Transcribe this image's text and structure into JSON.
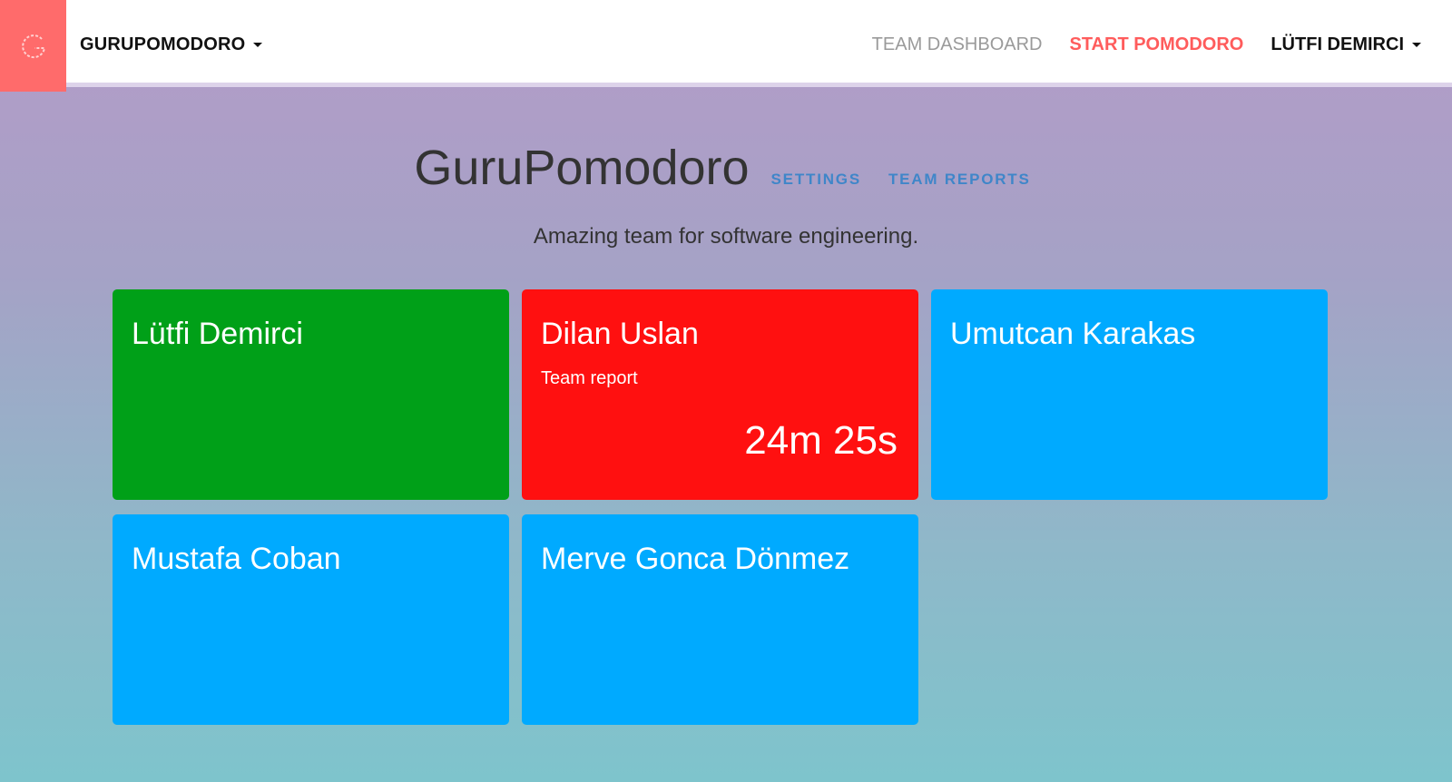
{
  "navbar": {
    "logo_letter": "G",
    "brand": "GURUPOMODORO",
    "links": {
      "dashboard": "TEAM DASHBOARD",
      "start": "START POMODORO",
      "user": "LÜTFI DEMIRCI"
    }
  },
  "header": {
    "title": "GuruPomodoro",
    "settings": "SETTINGS",
    "reports": "TEAM REPORTS",
    "tagline": "Amazing team for software engineering."
  },
  "members": [
    {
      "name": "Lütfi Demirci",
      "status_color": "#00a018",
      "task": "",
      "timer": ""
    },
    {
      "name": "Dilan Uslan",
      "status_color": "#ff1010",
      "task": "Team report",
      "timer": "24m 25s"
    },
    {
      "name": "Umutcan Karakas",
      "status_color": "#00aaff",
      "task": "",
      "timer": ""
    },
    {
      "name": "Mustafa Coban",
      "status_color": "#00aaff",
      "task": "",
      "timer": ""
    },
    {
      "name": "Merve Gonca Dönmez",
      "status_color": "#00aaff",
      "task": "",
      "timer": ""
    }
  ],
  "colors": {
    "accent": "#ff6b6b",
    "link_blue": "#3f86c9",
    "working": "#ff1010",
    "available": "#00aaff",
    "online": "#00a018"
  }
}
